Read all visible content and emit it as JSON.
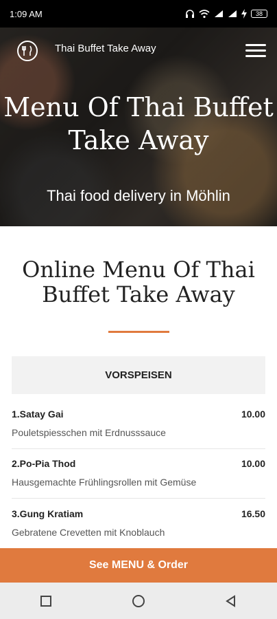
{
  "status_bar": {
    "time": "1:09 AM",
    "battery": "38"
  },
  "header": {
    "brand": "Thai Buffet Take Away"
  },
  "hero": {
    "title": "Menu Of Thai Buffet Take Away",
    "subtitle": "Thai food delivery in Möhlin"
  },
  "menu": {
    "heading": "Online Menu Of Thai Buffet Take Away",
    "category": "VORSPEISEN",
    "items": [
      {
        "name": "1.Satay Gai",
        "price": "10.00",
        "desc": "Pouletspiesschen mit Erdnusssauce"
      },
      {
        "name": "2.Po-Pia Thod",
        "price": "10.00",
        "desc": "Hausgemachte Frühlingsrollen mit Gemüse"
      },
      {
        "name": "3.Gung Kratiam",
        "price": "16.50",
        "desc": "Gebratene Crevetten mit Knoblauch"
      }
    ]
  },
  "cta": {
    "label": "See MENU & Order"
  },
  "colors": {
    "accent": "#e07a3e",
    "category_bg": "#f2f2f2"
  },
  "icons": [
    "logo-icon",
    "hamburger-menu-icon",
    "headphones-icon",
    "wifi-icon",
    "signal-icon",
    "battery-icon",
    "nav-recents-icon",
    "nav-home-icon",
    "nav-back-icon"
  ]
}
